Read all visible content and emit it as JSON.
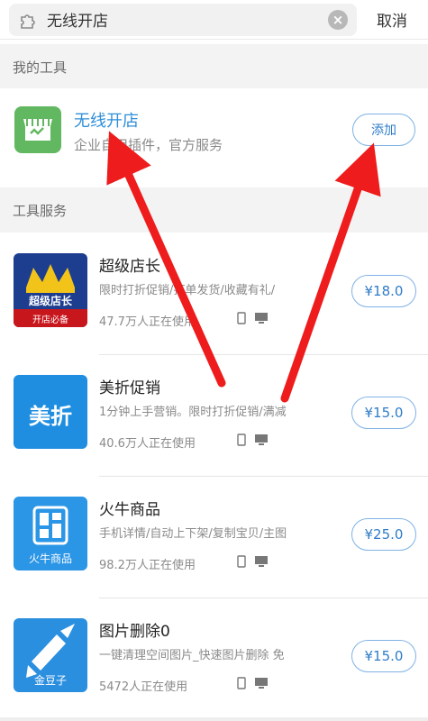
{
  "search": {
    "query": "无线开店"
  },
  "header": {
    "cancel_label": "取消"
  },
  "sections": {
    "my_tools": "我的工具",
    "tool_services": "工具服务"
  },
  "my_tool": {
    "name": "无线开店",
    "description": "企业自用插件，官方服务",
    "add_label": "添加"
  },
  "services": [
    {
      "name": "超级店长",
      "description": "限时打折促销/打单发货/收藏有礼/",
      "users": "47.7万人正在使用",
      "price": "¥18.0",
      "icon_lines": [
        "超级店长",
        "开店必备"
      ]
    },
    {
      "name": "美折促销",
      "description": "1分钟上手营销。限时打折促销/满减",
      "users": "40.6万人正在使用",
      "price": "¥15.0",
      "icon_lines": [
        "美折"
      ]
    },
    {
      "name": "火牛商品",
      "description": "手机详情/自动上下架/复制宝贝/主图",
      "users": "98.2万人正在使用",
      "price": "¥25.0",
      "icon_lines": [
        "火牛商品"
      ]
    },
    {
      "name": "图片删除0",
      "description": "一键清理空间图片_快速图片删除 免",
      "users": "5472人正在使用",
      "price": "¥15.0",
      "icon_lines": [
        "金豆子"
      ]
    }
  ],
  "colors": {
    "accent": "#2f7cc8",
    "link": "#2f8fd8",
    "arrow": "#ee1c1c",
    "section_bg": "#f3f3f3"
  }
}
